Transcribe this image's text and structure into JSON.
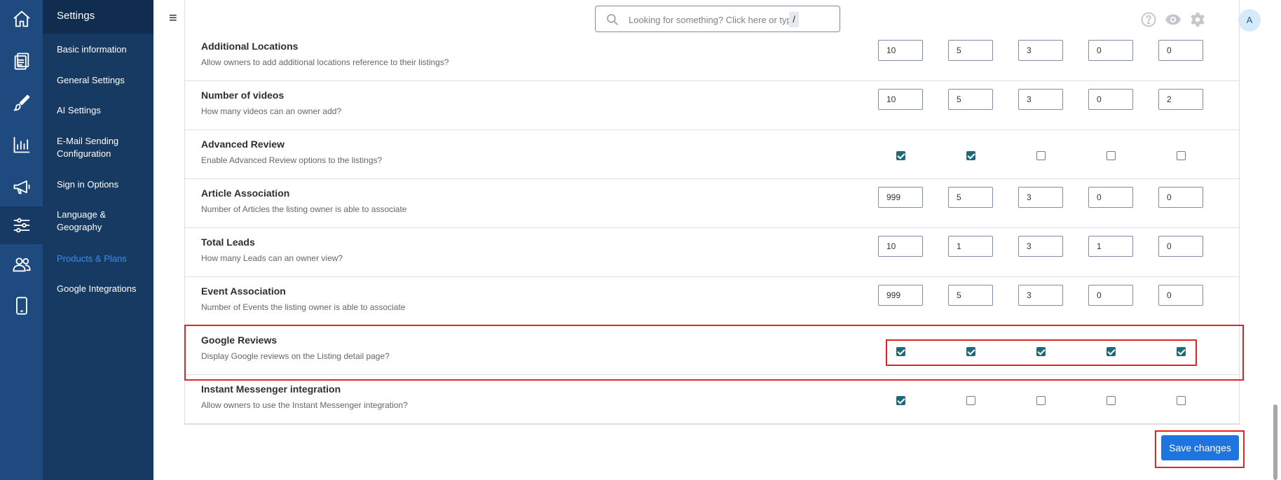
{
  "rail": {
    "icons": [
      "home-icon",
      "documents-icon",
      "brush-icon",
      "bar-chart-icon",
      "megaphone-icon",
      "sliders-icon",
      "users-icon",
      "mobile-icon"
    ]
  },
  "menu": {
    "title": "Settings",
    "items": [
      {
        "label": "Basic information",
        "active": false
      },
      {
        "label": "General Settings",
        "active": false
      },
      {
        "label": "AI Settings",
        "active": false
      },
      {
        "label": "E-Mail Sending Configuration",
        "active": false
      },
      {
        "label": "Sign in Options",
        "active": false
      },
      {
        "label": "Language & Geography",
        "active": false
      },
      {
        "label": "Products & Plans",
        "active": true
      },
      {
        "label": "Google Integrations",
        "active": false
      }
    ]
  },
  "topbar": {
    "menu_icon": "≡",
    "search_placeholder": "Looking for something? Click here or type",
    "search_shortcut": "/",
    "avatar_initial": "A"
  },
  "features": [
    {
      "title": "Additional Locations",
      "desc": "Allow owners to add additional locations reference to their listings?",
      "type": "number",
      "values": [
        "10",
        "5",
        "3",
        "0",
        "0"
      ]
    },
    {
      "title": "Number of videos",
      "desc": "How many videos can an owner add?",
      "type": "number",
      "values": [
        "10",
        "5",
        "3",
        "0",
        "2"
      ]
    },
    {
      "title": "Advanced Review",
      "desc": "Enable Advanced Review options to the listings?",
      "type": "checkbox",
      "values": [
        true,
        true,
        false,
        false,
        false
      ]
    },
    {
      "title": "Article Association",
      "desc": "Number of Articles the listing owner is able to associate",
      "type": "number",
      "values": [
        "999",
        "5",
        "3",
        "0",
        "0"
      ]
    },
    {
      "title": "Total Leads",
      "desc": "How many Leads can an owner view?",
      "type": "number",
      "values": [
        "10",
        "1",
        "3",
        "1",
        "0"
      ]
    },
    {
      "title": "Event Association",
      "desc": "Number of Events the listing owner is able to associate",
      "type": "number",
      "values": [
        "999",
        "5",
        "3",
        "0",
        "0"
      ]
    },
    {
      "title": "Google Reviews",
      "desc": "Display Google reviews on the Listing detail page?",
      "type": "checkbox",
      "values": [
        true,
        true,
        true,
        true,
        true
      ]
    },
    {
      "title": "Instant Messenger integration",
      "desc": "Allow owners to use the Instant Messenger integration?",
      "type": "checkbox",
      "values": [
        true,
        false,
        false,
        false,
        false
      ]
    }
  ],
  "save_label": "Save changes",
  "colors": {
    "accent": "#1f75e0",
    "rail": "#1e4a7f",
    "menu": "#173a63",
    "highlight": "#e02424",
    "checked": "#1c6b7a"
  }
}
